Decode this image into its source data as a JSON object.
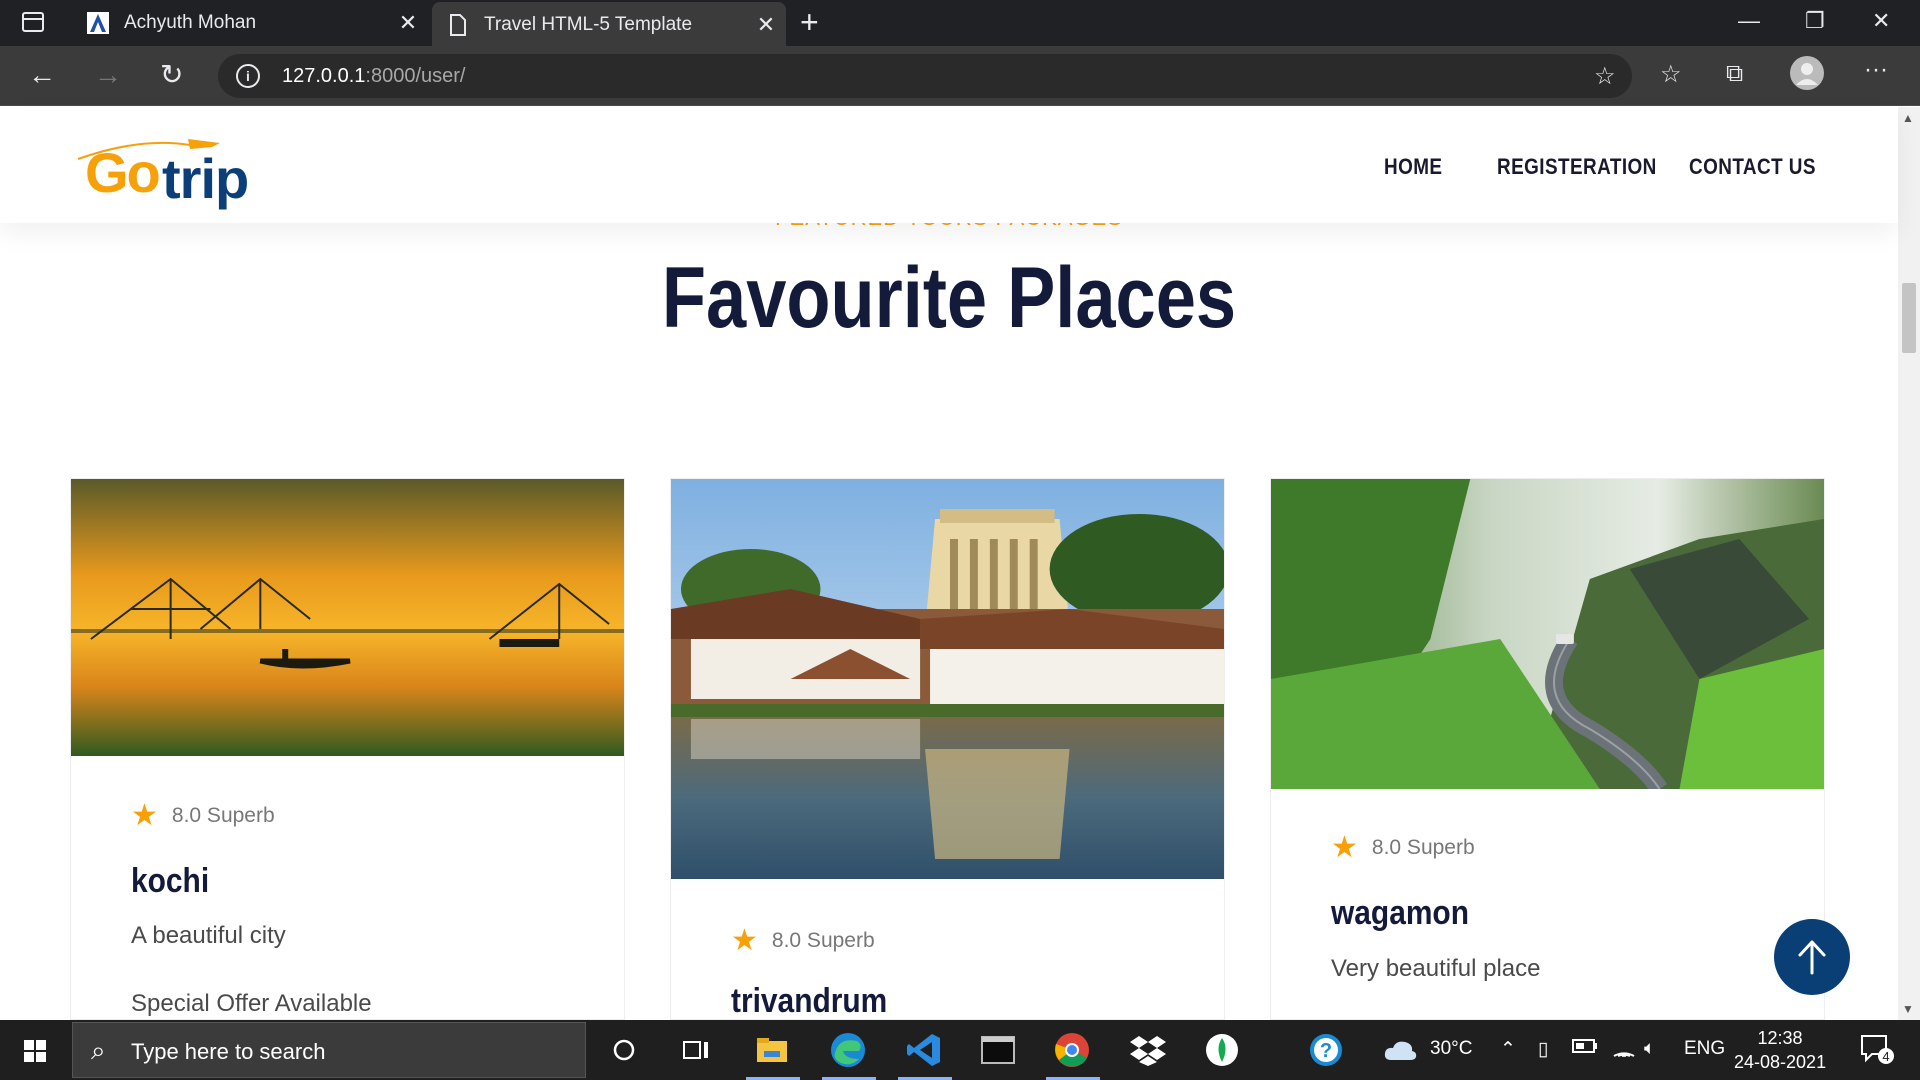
{
  "browser": {
    "tabs": [
      {
        "title": "Achyuth Mohan",
        "icon": "a-logo-icon"
      },
      {
        "title": "Travel HTML-5 Template",
        "icon": "page-icon"
      }
    ],
    "url_host": "127.0.0.1",
    "url_rest": ":8000/user/"
  },
  "header": {
    "logo_go": "Go",
    "logo_trip": "trip",
    "nav": [
      "HOME",
      "REGISTERATION",
      "CONTACT US"
    ]
  },
  "section": {
    "subtitle": "FEATURED TOURS PACKAGES",
    "title": "Favourite Places"
  },
  "cards": [
    {
      "rating": "8.0 Superb",
      "name": "kochi",
      "desc": "A beautiful city",
      "offer": "Special Offer Available"
    },
    {
      "rating": "8.0 Superb",
      "name": "trivandrum",
      "desc": "",
      "offer": ""
    },
    {
      "rating": "8.0 Superb",
      "name": "wagamon",
      "desc": "Very beautiful place",
      "offer": ""
    }
  ],
  "taskbar": {
    "search_placeholder": "Type here to search",
    "weather": "30°C",
    "lang": "ENG",
    "time": "12:38",
    "date": "24-08-2021",
    "notifications": "4"
  },
  "colors": {
    "accent_orange": "#f6a10a",
    "brand_navy": "#0c3f79",
    "title_dark": "#131a3a"
  }
}
